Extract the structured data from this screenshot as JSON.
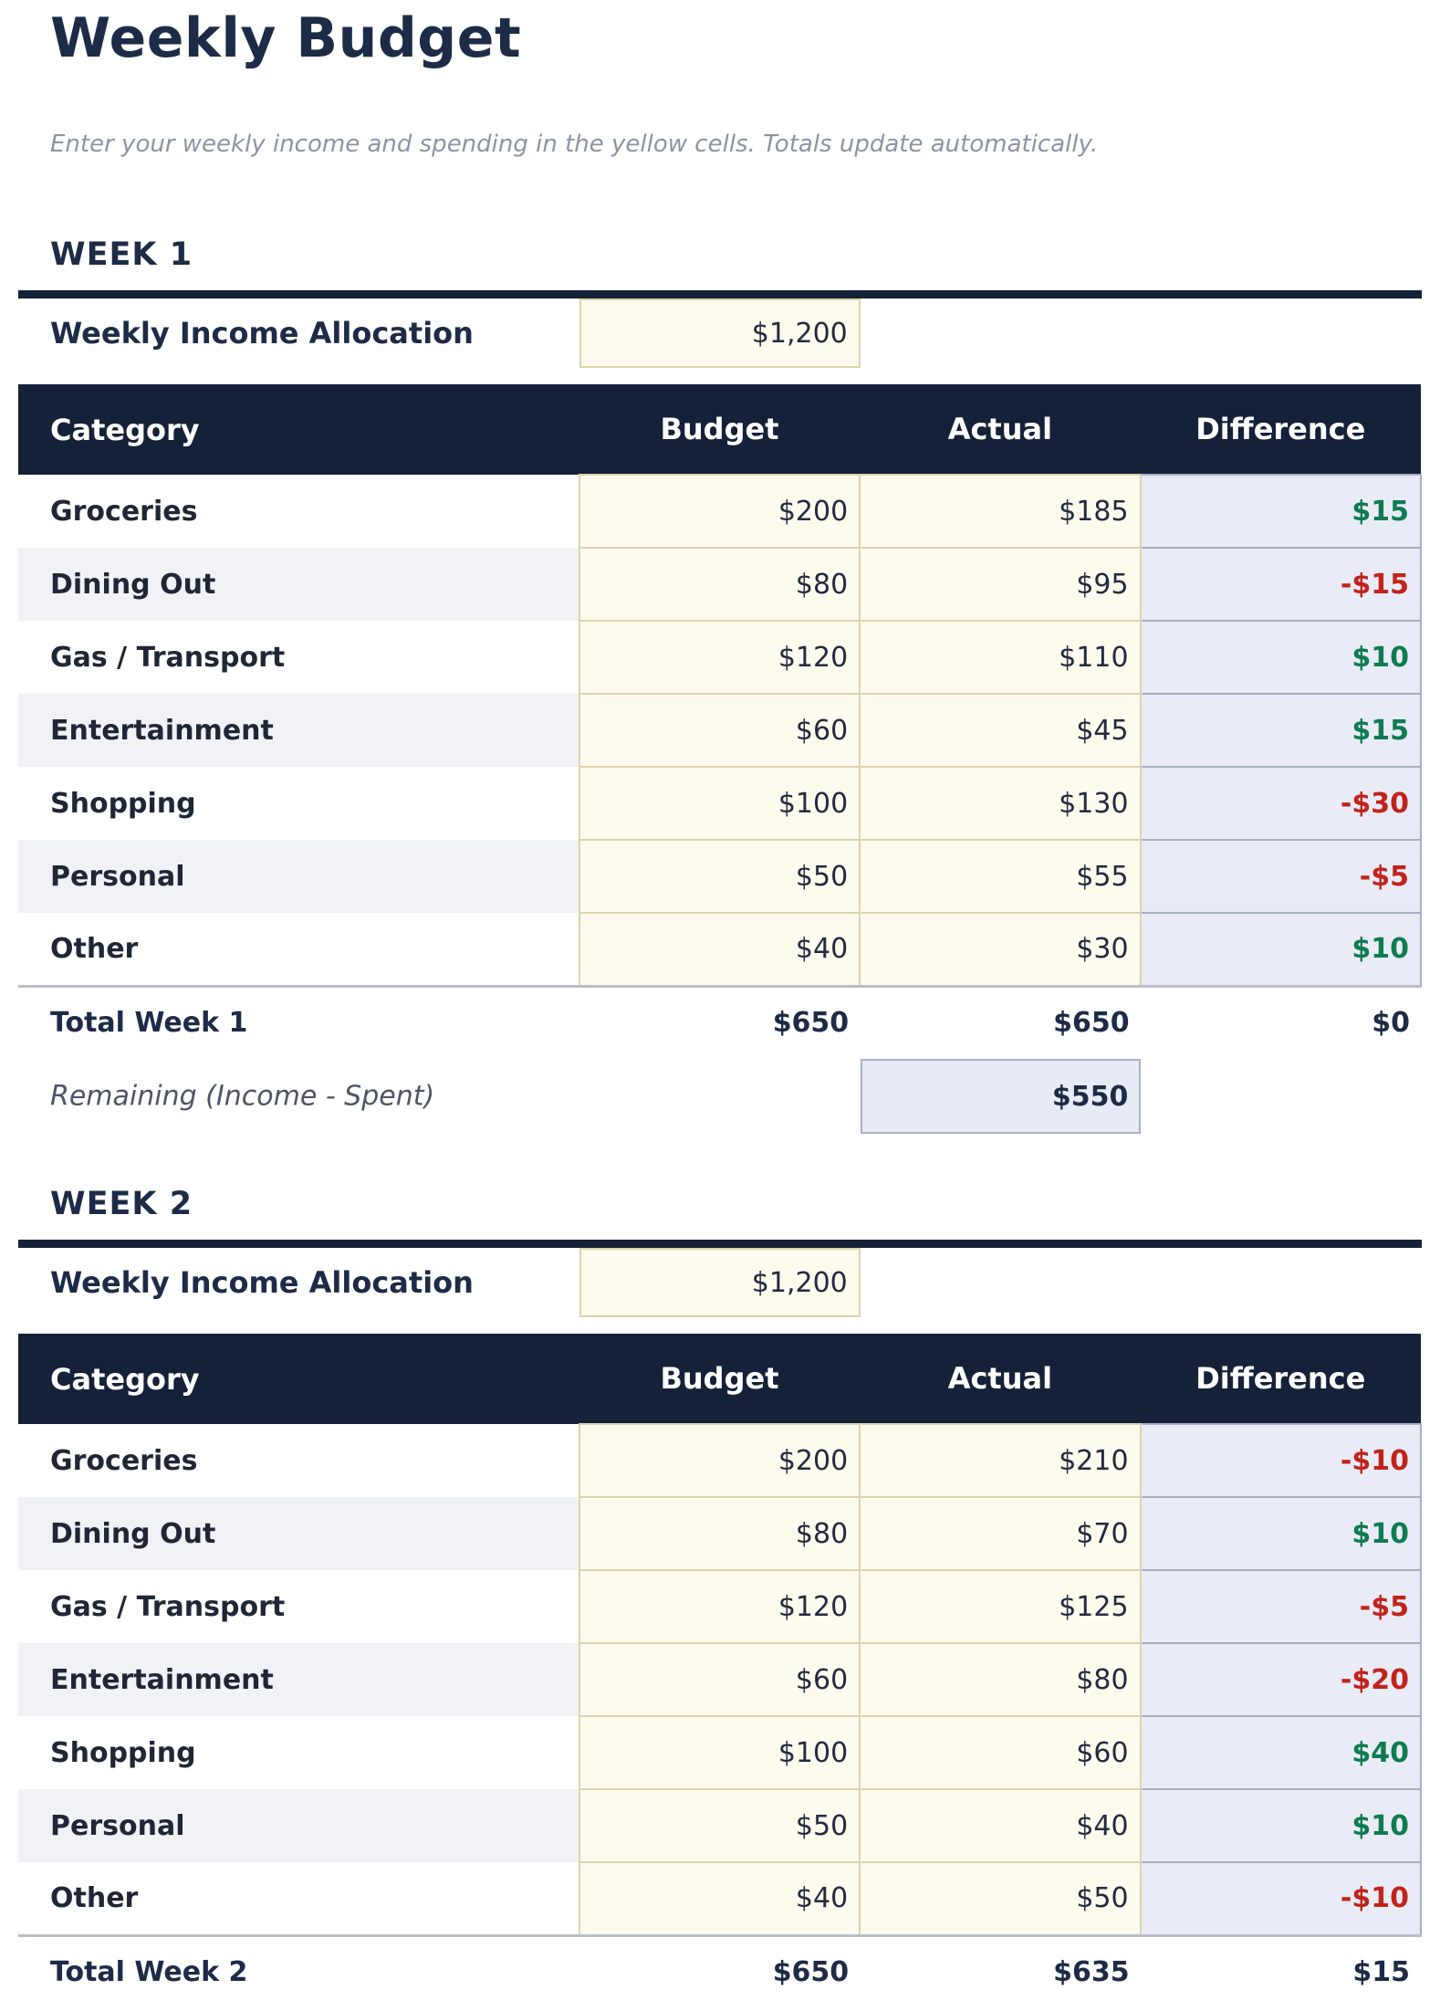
{
  "page": {
    "title": "Weekly Budget",
    "subtitle": "Enter your weekly income and spending in the yellow cells. Totals update automatically."
  },
  "income_label": "Weekly Income Allocation",
  "remaining_label": "Remaining (Income - Spent)",
  "table_headers": [
    "Category",
    "Budget",
    "Actual",
    "Difference"
  ],
  "colors": {
    "header_bg": "#152138",
    "heading_text": "#1d2b47",
    "positive": "#0e7c4f",
    "negative": "#c1231c",
    "input_cell_bg": "#fdfaee",
    "input_cell_border": "#ddd3ab",
    "computed_cell_bg": "#e9ecf6",
    "computed_cell_border": "#a6aec6",
    "alt_row_bg": "#f1f2f6"
  },
  "weeks": [
    {
      "label": "WEEK 1",
      "income": "$1,200",
      "rows": [
        {
          "category": "Groceries",
          "budget": "$200",
          "actual": "$185",
          "diff": "$15",
          "diff_type": "pos"
        },
        {
          "category": "Dining Out",
          "budget": "$80",
          "actual": "$95",
          "diff": "-$15",
          "diff_type": "neg"
        },
        {
          "category": "Gas / Transport",
          "budget": "$120",
          "actual": "$110",
          "diff": "$10",
          "diff_type": "pos"
        },
        {
          "category": "Entertainment",
          "budget": "$60",
          "actual": "$45",
          "diff": "$15",
          "diff_type": "pos"
        },
        {
          "category": "Shopping",
          "budget": "$100",
          "actual": "$130",
          "diff": "-$30",
          "diff_type": "neg"
        },
        {
          "category": "Personal",
          "budget": "$50",
          "actual": "$55",
          "diff": "-$5",
          "diff_type": "neg"
        },
        {
          "category": "Other",
          "budget": "$40",
          "actual": "$30",
          "diff": "$10",
          "diff_type": "pos"
        }
      ],
      "total": {
        "label": "Total Week 1",
        "budget": "$650",
        "actual": "$650",
        "diff": "$0",
        "diff_type": "zero"
      },
      "remaining": "$550",
      "show_remaining": true
    },
    {
      "label": "WEEK 2",
      "income": "$1,200",
      "rows": [
        {
          "category": "Groceries",
          "budget": "$200",
          "actual": "$210",
          "diff": "-$10",
          "diff_type": "neg"
        },
        {
          "category": "Dining Out",
          "budget": "$80",
          "actual": "$70",
          "diff": "$10",
          "diff_type": "pos"
        },
        {
          "category": "Gas / Transport",
          "budget": "$120",
          "actual": "$125",
          "diff": "-$5",
          "diff_type": "neg"
        },
        {
          "category": "Entertainment",
          "budget": "$60",
          "actual": "$80",
          "diff": "-$20",
          "diff_type": "neg"
        },
        {
          "category": "Shopping",
          "budget": "$100",
          "actual": "$60",
          "diff": "$40",
          "diff_type": "pos"
        },
        {
          "category": "Personal",
          "budget": "$50",
          "actual": "$40",
          "diff": "$10",
          "diff_type": "pos"
        },
        {
          "category": "Other",
          "budget": "$40",
          "actual": "$50",
          "diff": "-$10",
          "diff_type": "neg"
        }
      ],
      "total": {
        "label": "Total Week 2",
        "budget": "$650",
        "actual": "$635",
        "diff": "$15",
        "diff_type": "pos"
      },
      "remaining": "",
      "show_remaining": false
    }
  ]
}
